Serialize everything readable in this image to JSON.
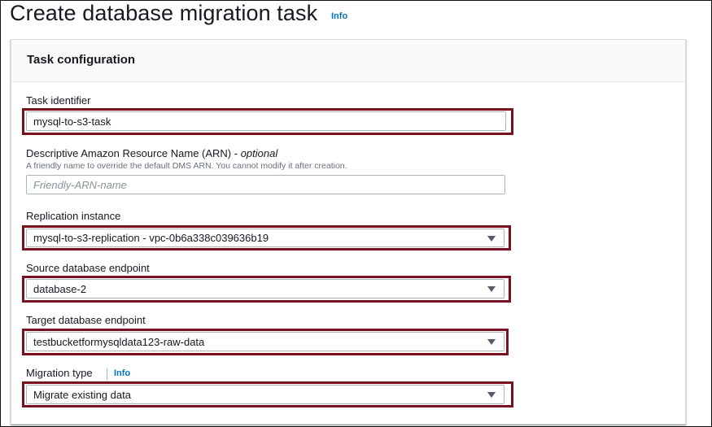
{
  "page": {
    "title": "Create database migration task",
    "info_link": "Info"
  },
  "panel": {
    "title": "Task configuration"
  },
  "task_identifier": {
    "label": "Task identifier",
    "value": "mysql-to-s3-task"
  },
  "arn": {
    "label": "Descriptive Amazon Resource Name (ARN) - ",
    "label_optional": "optional",
    "description": "A friendly name to override the default DMS ARN. You cannot modify it after creation.",
    "placeholder": "Friendly-ARN-name"
  },
  "replication_instance": {
    "label": "Replication instance",
    "value": "mysql-to-s3-replication - vpc-0b6a338c039636b19"
  },
  "source_endpoint": {
    "label": "Source database endpoint",
    "value": "database-2"
  },
  "target_endpoint": {
    "label": "Target database endpoint",
    "value": "testbucketformysqldata123-raw-data"
  },
  "migration_type": {
    "label": "Migration type",
    "info_link": "Info",
    "value": "Migrate existing data"
  },
  "colors": {
    "highlight_border": "#7b1020",
    "link": "#0073bb"
  }
}
